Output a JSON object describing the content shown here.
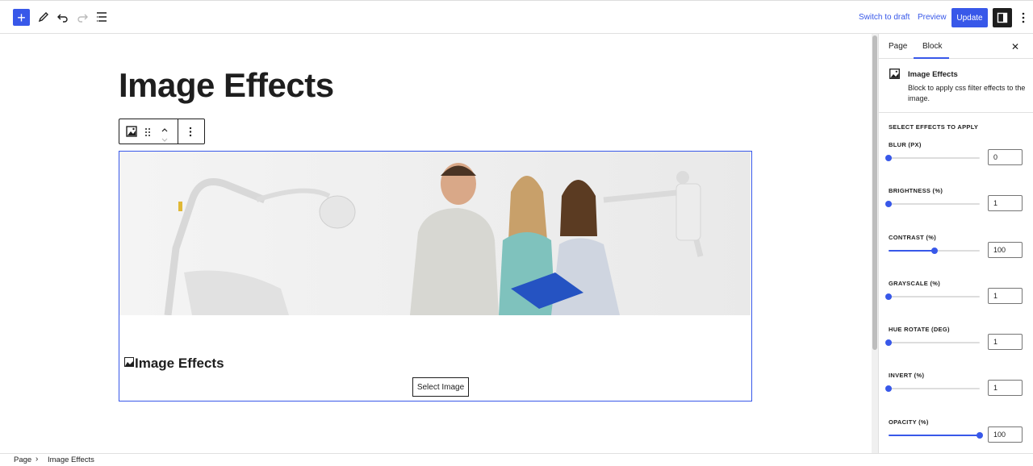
{
  "topbar": {
    "switch_draft": "Switch to draft",
    "preview": "Preview",
    "update": "Update"
  },
  "editor": {
    "title": "Image Effects",
    "block": {
      "heading": "Image Effects",
      "select_button": "Select Image"
    }
  },
  "sidebar": {
    "tabs": [
      "Page",
      "Block"
    ],
    "active_tab": "Block",
    "block_card": {
      "title": "Image Effects",
      "description": "Block to apply css filter effects to the image."
    },
    "section_label": "SELECT EFFECTS TO APPLY",
    "controls": [
      {
        "label": "BLUR (PX)",
        "value": "0",
        "position": 0.0
      },
      {
        "label": "BRIGHTNESS (%)",
        "value": "1",
        "position": 0.0
      },
      {
        "label": "CONTRAST (%)",
        "value": "100",
        "position": 0.5
      },
      {
        "label": "GRAYSCALE (%)",
        "value": "1",
        "position": 0.0
      },
      {
        "label": "HUE ROTATE (DEG)",
        "value": "1",
        "position": 0.0
      },
      {
        "label": "INVERT (%)",
        "value": "1",
        "position": 0.0
      },
      {
        "label": "OPACITY (%)",
        "value": "100",
        "position": 1.0
      }
    ]
  },
  "footer": {
    "breadcrumb": [
      "Page",
      "Image Effects"
    ]
  },
  "colors": {
    "accent": "#3858e9",
    "dark": "#1e1e1e"
  }
}
